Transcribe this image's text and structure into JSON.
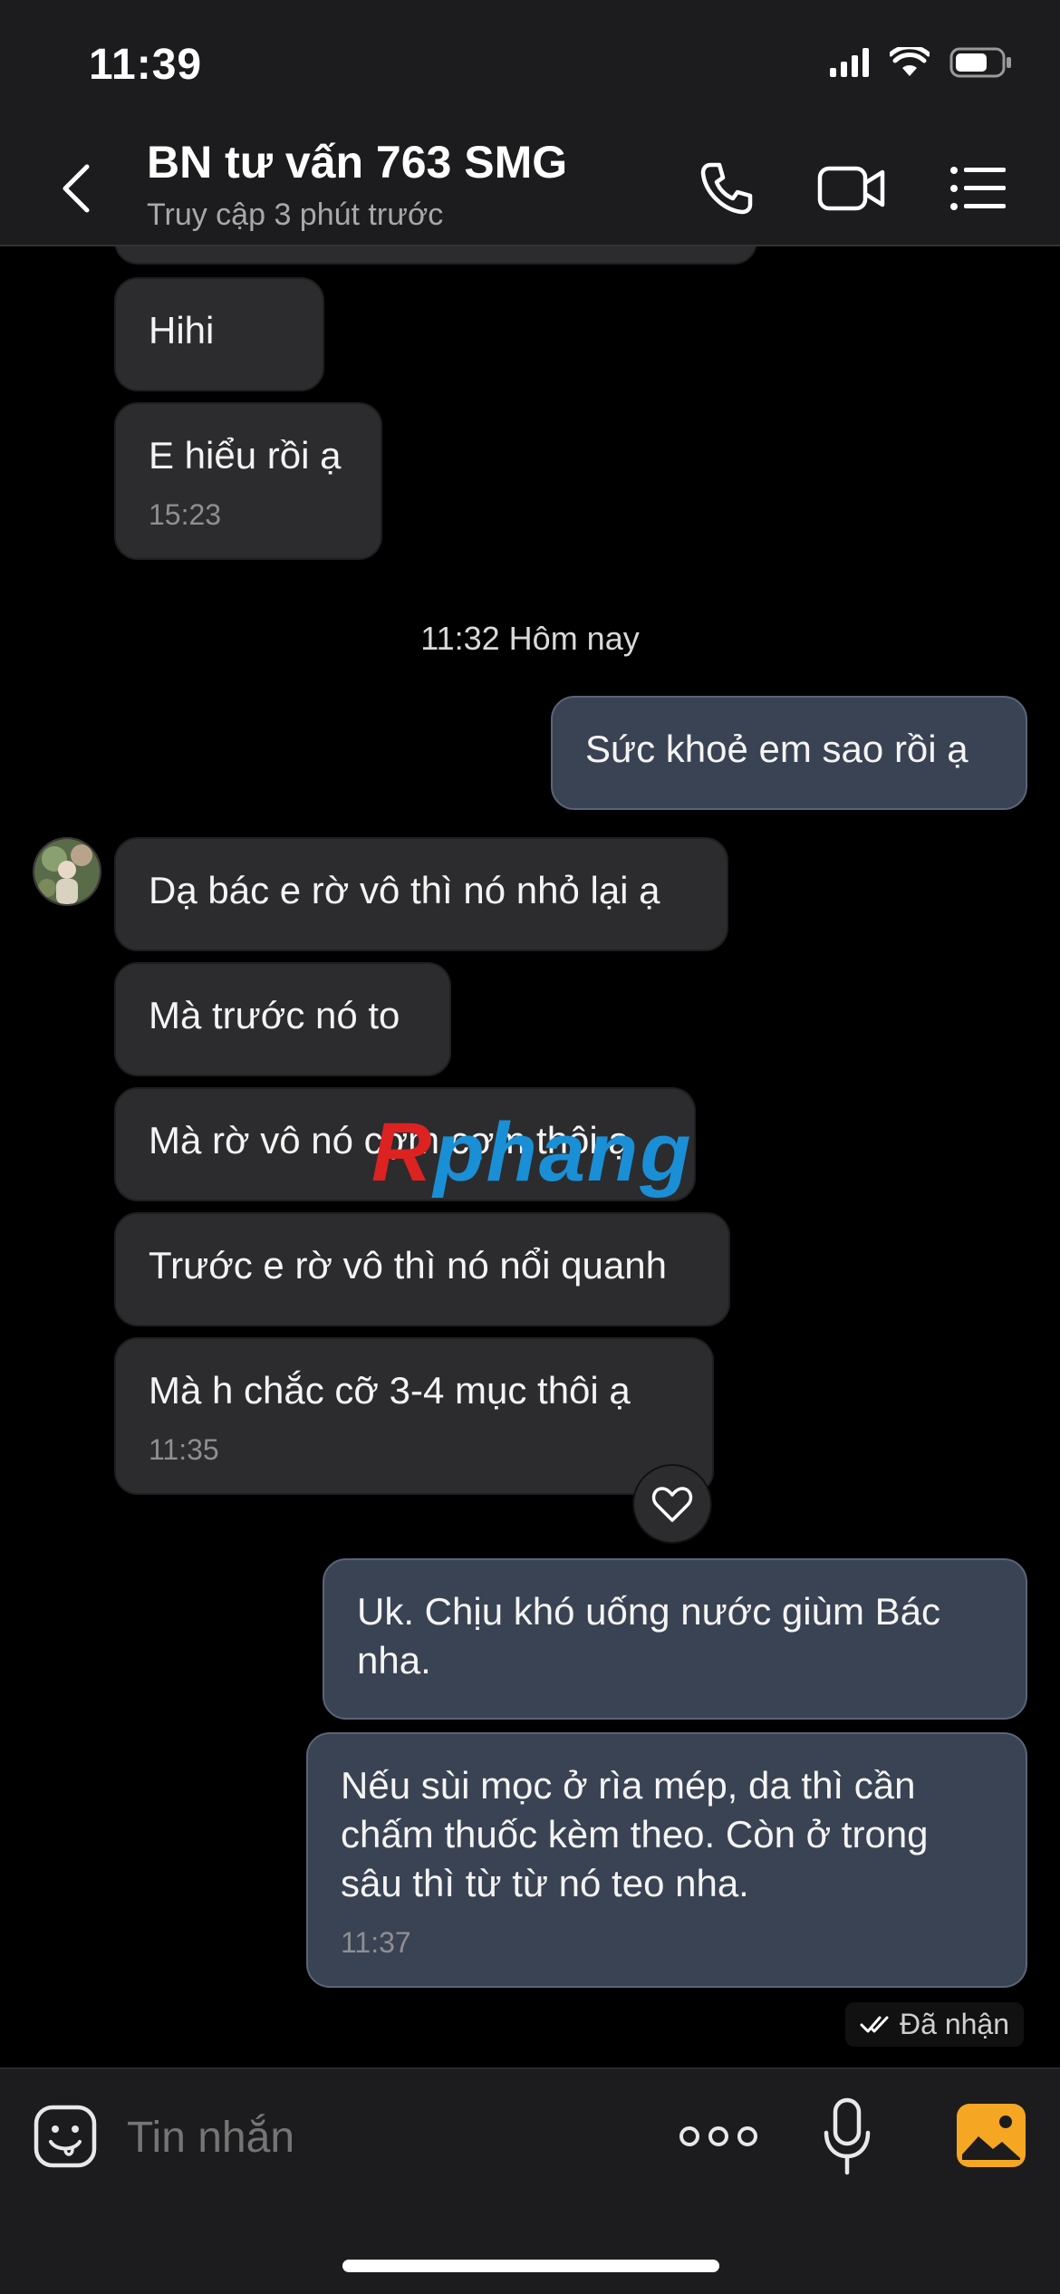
{
  "status_bar": {
    "time": "11:39"
  },
  "header": {
    "title": "BN tư vấn 763 SMG",
    "subtitle": "Truy cập 3 phút trước"
  },
  "messages": [
    {
      "dir": "in",
      "text": "Hihi"
    },
    {
      "dir": "in",
      "text": "E hiểu rồi ạ",
      "time": "15:23"
    },
    {
      "dir": "out",
      "text": "Sức khoẻ em sao rồi ạ"
    },
    {
      "dir": "in",
      "text": "Dạ bác e rờ vô thì nó nhỏ lại ạ"
    },
    {
      "dir": "in",
      "text": "Mà trước nó to"
    },
    {
      "dir": "in",
      "text": "Mà rờ vô nó cợm cợm thôi ạ"
    },
    {
      "dir": "in",
      "text": "Trước e rờ vô thì nó nổi quanh"
    },
    {
      "dir": "in",
      "text": "Mà h chắc cỡ 3-4 mục thôi ạ",
      "time": "11:35"
    },
    {
      "dir": "out",
      "text": "Uk. Chịu khó uống nước giùm Bác nha."
    },
    {
      "dir": "out",
      "text": "Nếu sùi mọc ở rìa mép, da thì cần chấm thuốc kèm theo. Còn ở trong sâu thì từ từ nó teo nha.",
      "time": "11:37"
    }
  ],
  "date_separator": "11:32 Hôm nay",
  "receipt": "Đã nhận",
  "watermark": {
    "first": "R",
    "rest": "phang"
  },
  "composer": {
    "placeholder": "Tin nhắn"
  },
  "colors": {
    "incoming_bubble": "#2c2c2e",
    "outgoing_bubble": "#3a4353",
    "photo_button": "#f5a623"
  }
}
